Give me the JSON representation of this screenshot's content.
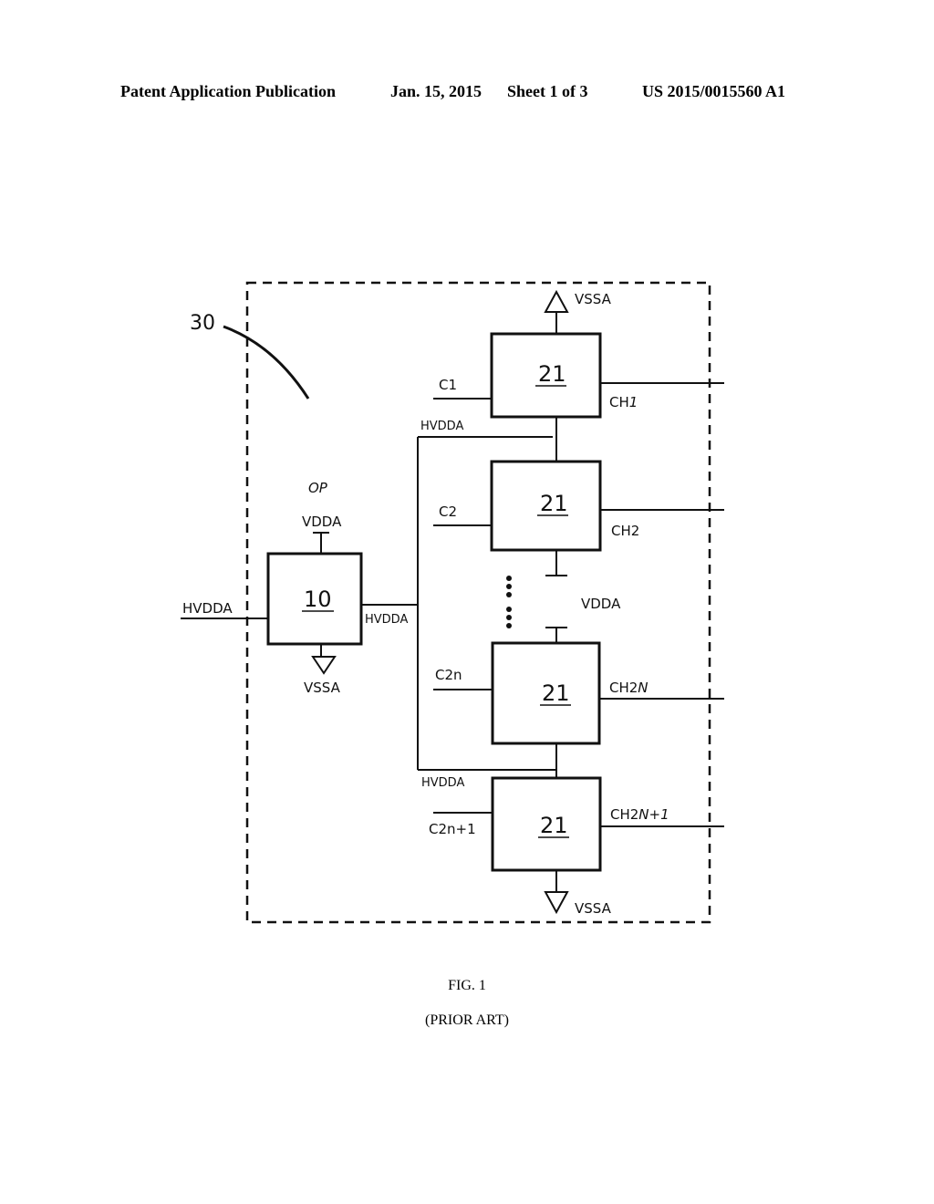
{
  "header": {
    "publication": "Patent Application Publication",
    "date": "Jan. 15, 2015",
    "sheet": "Sheet 1 of 3",
    "number": "US 2015/0015560 A1"
  },
  "figure": {
    "reference_label": "30",
    "op_label": "OP",
    "op_block": {
      "number": "10",
      "supply_top": "VDDA",
      "supply_bottom": "VSSA",
      "input_label": "HVDDA",
      "output_label": "HVDDA"
    },
    "channel_blocks": [
      {
        "number": "21",
        "control": "C1",
        "channel": "CH",
        "channel_suffix": "1"
      },
      {
        "number": "21",
        "control": "C2",
        "channel": "CH2",
        "channel_suffix": ""
      },
      {
        "number": "21",
        "control": "C2n",
        "channel": "CH2",
        "channel_suffix": "N"
      },
      {
        "number": "21",
        "control": "C2n+1",
        "channel": "CH2",
        "channel_suffix": "N+1"
      }
    ],
    "top_supply": "VSSA",
    "bottom_supply": "VSSA",
    "mid_supply": "VDDA",
    "hvdda_top": "HVDDA",
    "hvdda_bottom": "HVDDA"
  },
  "caption": {
    "figure": "FIG. 1",
    "note": "(PRIOR ART)"
  }
}
